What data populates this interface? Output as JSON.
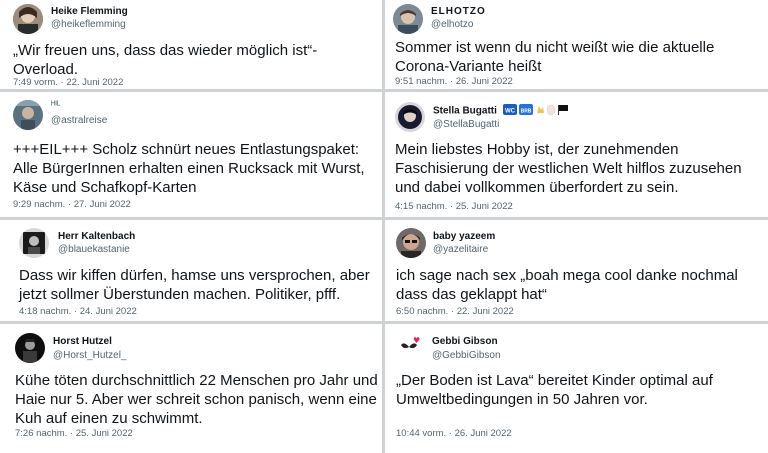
{
  "tweets": [
    {
      "name": "Heike Flemming",
      "handle": "@heikeflemming",
      "text": "„Wir freuen uns, dass das wieder möglich ist“-\nOverload.",
      "time": "7:49 vorm. · 22. Juni 2022"
    },
    {
      "name": "ELHOTZO",
      "handle": "@elhotzo",
      "text": "Sommer ist wenn du nicht weißt wie die aktuelle\nCorona-Variante heißt",
      "time": "9:51 nachm. · 26. Juni 2022"
    },
    {
      "name": "ᴴᴵᴸ",
      "handle": "@astralreise",
      "text": "+++EIL+++ Scholz schnürt neues Entlastungspaket:\nAlle BürgerInnen erhalten einen Rucksack mit Wurst,\nKäse und Schafkopf-Karten",
      "time": "9:29 nachm. · 27. Juni 2022"
    },
    {
      "name": "Stella Bugatti",
      "handle": "@StellaBugatti",
      "text": "Mein liebstes Hobby ist, der zunehmenden\nFaschisierung der westlichen Welt hilflos zuzusehen\nund dabei vollkommen überfordert zu sein.",
      "time": "4:15 nachm. · 25. Juni 2022"
    },
    {
      "name": "Herr Kaltenbach",
      "handle": "@blauekastanie",
      "text": "Dass wir kiffen dürfen, hamse uns versprochen, aber\njetzt sollmer Überstunden machen. Politiker, pfff.",
      "time": "4:18 nachm. · 24. Juni 2022"
    },
    {
      "name": "baby yazeem",
      "handle": "@yazelitaire",
      "text": "ich sage nach sex „boah mega cool danke nochmal\ndass das geklappt hat“",
      "time": "6:50 nachm. · 22. Juni 2022"
    },
    {
      "name": "Horst Hutzel",
      "handle": "@Horst_Hutzel_",
      "text": "Kühe töten durchschnittlich 22 Menschen pro Jahr und\nHaie nur 5. Aber wer schreit schon panisch, wenn eine\nKuh auf einen zu schwimmt.",
      "time": "7:26 nachm. · 25. Juni 2022"
    },
    {
      "name": "Gebbi Gibson",
      "handle": "@GebbiGibson",
      "text": "„Der Boden ist Lava“ bereitet Kinder optimal auf\nUmweltbedingungen in 50 Jahren vor.",
      "time": "10:44 vorm. · 26. Juni 2022"
    }
  ],
  "badges": {
    "wc": "WC",
    "brb": "BRB"
  },
  "colors": {
    "divider": "#cfd2d5",
    "text": "#0f1419",
    "muted": "#536471"
  }
}
